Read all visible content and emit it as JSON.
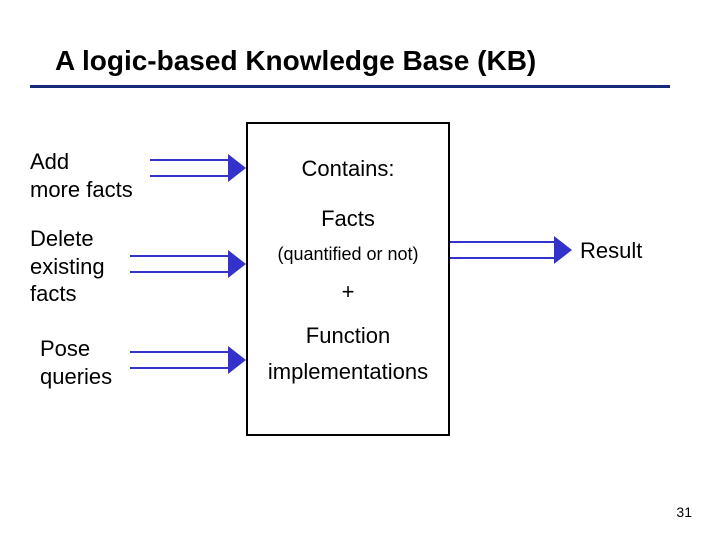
{
  "title": "A logic-based Knowledge Base (KB)",
  "left": {
    "add": "Add\nmore facts",
    "delete": "Delete\nexisting\nfacts",
    "pose": "Pose\nqueries"
  },
  "kb": {
    "contains": "Contains:",
    "facts": "Facts",
    "quantified": "(quantified or not)",
    "plus": "+",
    "function": "Function",
    "implementations": "implementations"
  },
  "right": {
    "result": "Result"
  },
  "page_number": "31",
  "colors": {
    "rule": "#1a2a7a",
    "arrow": "#3333cc"
  }
}
